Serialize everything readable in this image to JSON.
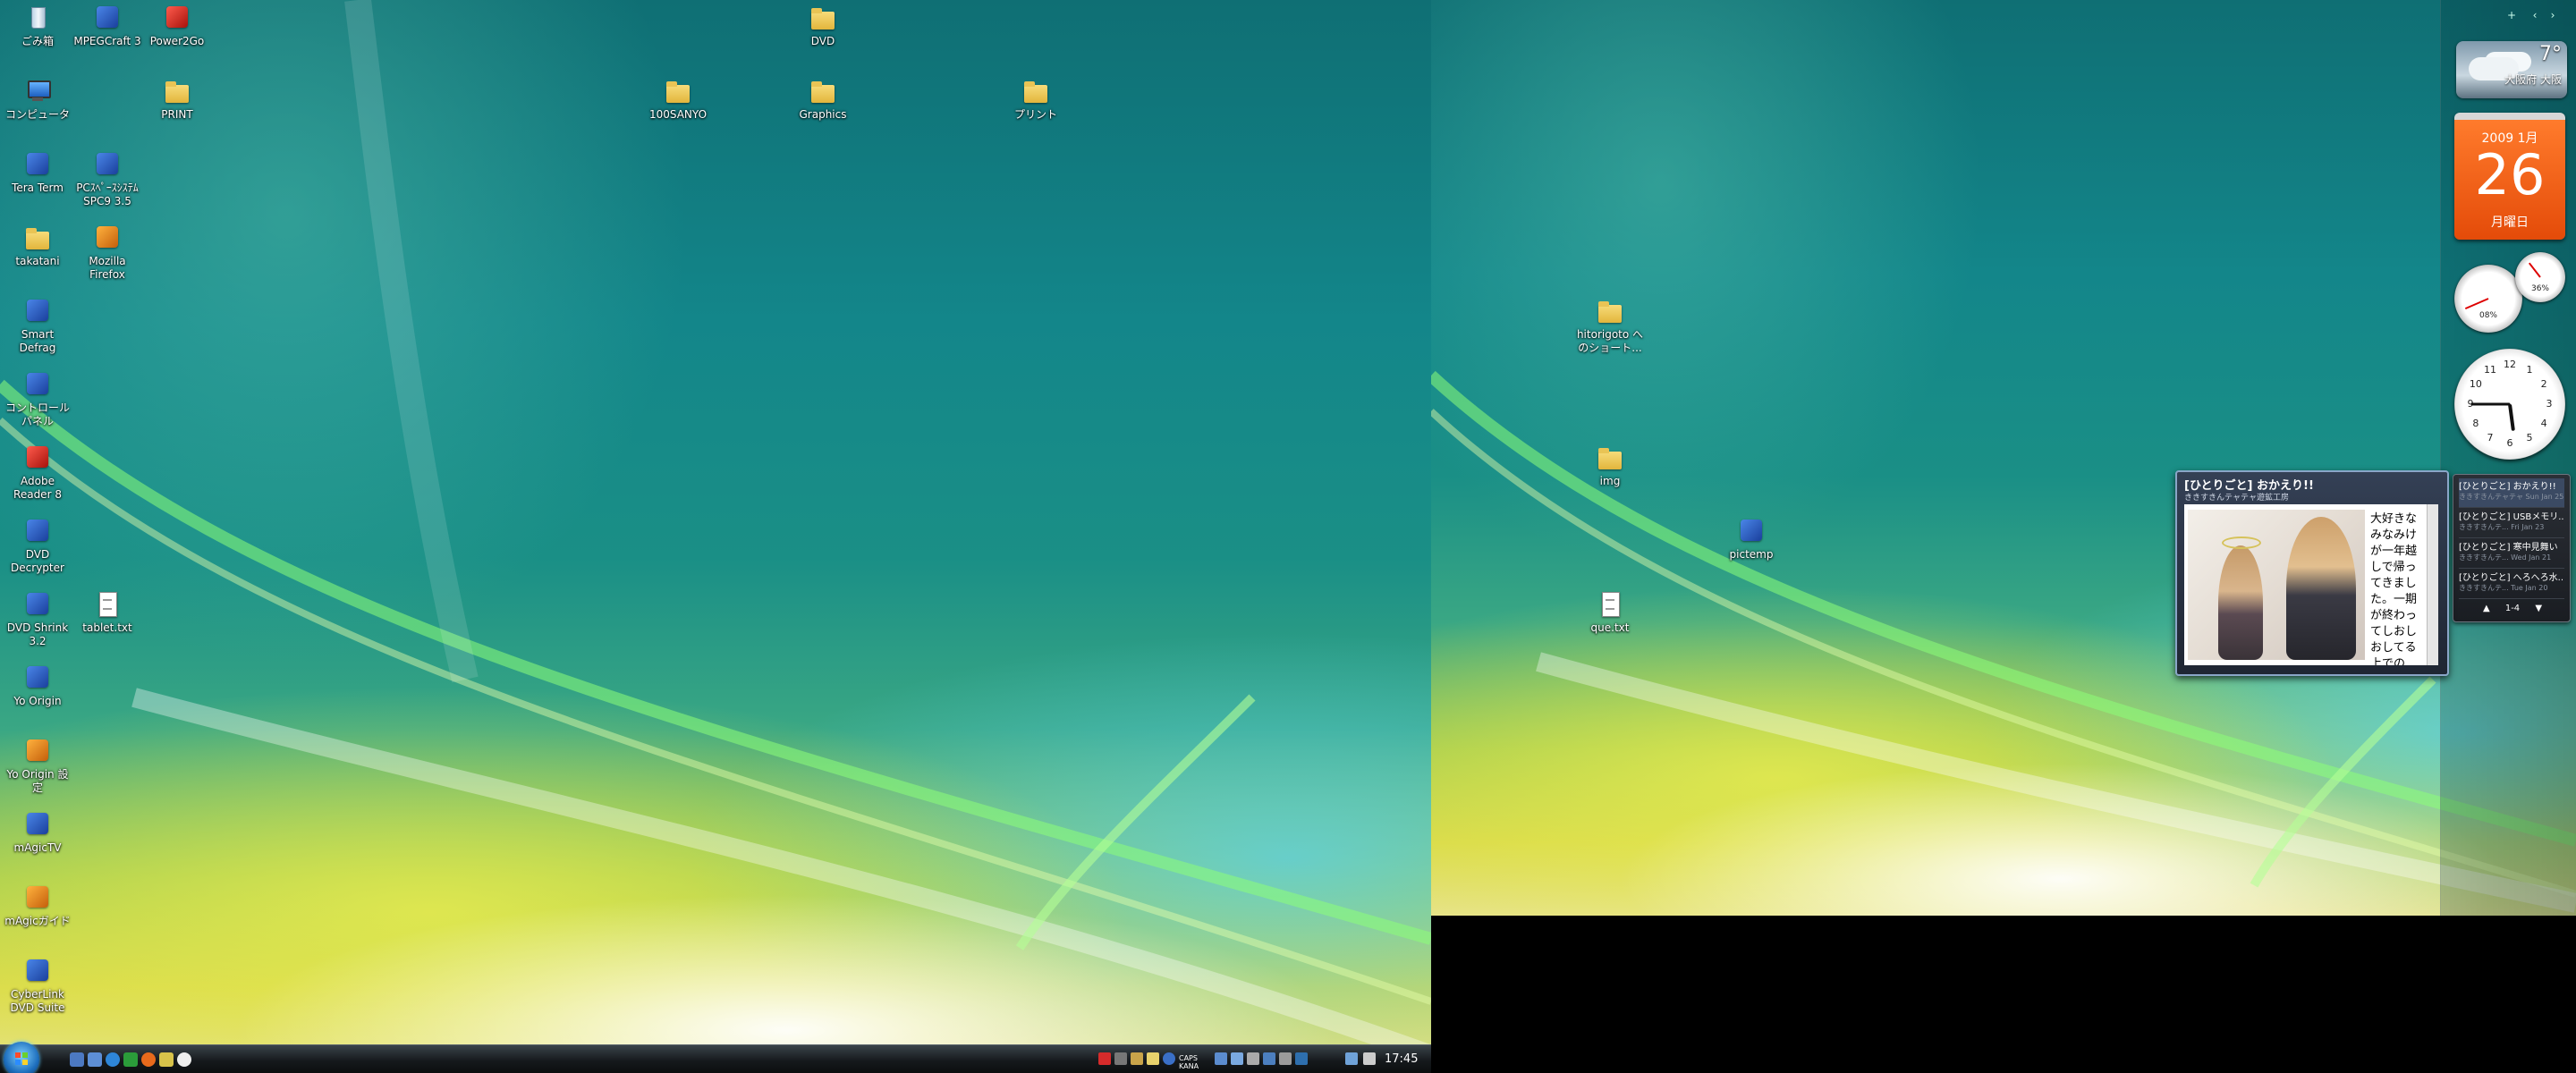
{
  "left_desktop": {
    "icons": [
      {
        "label": "ごみ箱",
        "type": "recycle"
      },
      {
        "label": "MPEGCraft 3",
        "type": "app"
      },
      {
        "label": "Power2Go",
        "type": "app"
      },
      {
        "label": "DVD",
        "type": "folder"
      },
      {
        "label": "コンピュータ",
        "type": "pc"
      },
      {
        "label": "PRINT",
        "type": "folder"
      },
      {
        "label": "100SANYO",
        "type": "folder"
      },
      {
        "label": "Graphics",
        "type": "folder"
      },
      {
        "label": "プリント",
        "type": "folder"
      },
      {
        "label": "Tera Term",
        "type": "app"
      },
      {
        "label": "PCｽﾍﾟｰｽｼｽﾃﾑ\nSPC9 3.5",
        "type": "app"
      },
      {
        "label": "takatani",
        "type": "folder"
      },
      {
        "label": "Mozilla\nFirefox",
        "type": "app"
      },
      {
        "label": "Smart\nDefrag",
        "type": "app"
      },
      {
        "label": "コントロール\nパネル",
        "type": "app"
      },
      {
        "label": "Adobe\nReader 8",
        "type": "red"
      },
      {
        "label": "DVD\nDecrypter",
        "type": "app"
      },
      {
        "label": "DVD Shrink\n3.2",
        "type": "app"
      },
      {
        "label": "tablet.txt",
        "type": "file"
      },
      {
        "label": "Yo Origin",
        "type": "app"
      },
      {
        "label": "Yo Origin 設\n定",
        "type": "orange"
      },
      {
        "label": "mAgicTV",
        "type": "app"
      },
      {
        "label": "mAgicガイド",
        "type": "orange"
      },
      {
        "label": "CyberLink\nDVD Suite",
        "type": "app"
      }
    ]
  },
  "taskbar": {
    "clock": "17:45",
    "tray_text": "CAPS\nKANA"
  },
  "right_desktop": {
    "icons": [
      {
        "label": "hitorigoto へ\nのショート...",
        "type": "folder"
      },
      {
        "label": "img",
        "type": "folder"
      },
      {
        "label": "pictemp",
        "type": "app"
      },
      {
        "label": "que.txt",
        "type": "file"
      }
    ]
  },
  "sidebar": {
    "buttons": [
      "+",
      "‹",
      "›"
    ],
    "weather": {
      "temp": "7°",
      "city": "大阪府 大阪"
    },
    "calendar": {
      "year_month": "2009 1月",
      "day": "26",
      "weekday": "月曜日"
    },
    "cpu_meter": {
      "cpu": "08%",
      "mem": "36%",
      "cpu_level": 0.08,
      "mem_level": 0.36
    },
    "clock": {
      "hour": 5,
      "minute": 45,
      "numbers": [
        "12",
        "1",
        "2",
        "3",
        "4",
        "5",
        "6",
        "7",
        "8",
        "9",
        "10",
        "11"
      ]
    },
    "feed": {
      "items": [
        {
          "title": "[ひとりごと] おかえり!!",
          "meta": "ききすきんテャテャ Sun Jan 25"
        },
        {
          "title": "[ひとりごと] USBメモリ...",
          "meta": "ききすきんテ... Fri Jan 23"
        },
        {
          "title": "[ひとりごと] 寒中見舞い",
          "meta": "ききすきんテ... Wed Jan 21"
        },
        {
          "title": "[ひとりごと] へろへろ水...",
          "meta": "ききすきんテ... Tue Jan 20"
        }
      ],
      "pager": "1-4"
    },
    "flyout": {
      "title": "[ひとりごと] おかえり!!",
      "source": "ききすきんテャテャ遊鉱工房",
      "text": "大好きなみなみけが一年越しで帰ってきました。一期が終わってしおしおしてる上での..."
    }
  }
}
